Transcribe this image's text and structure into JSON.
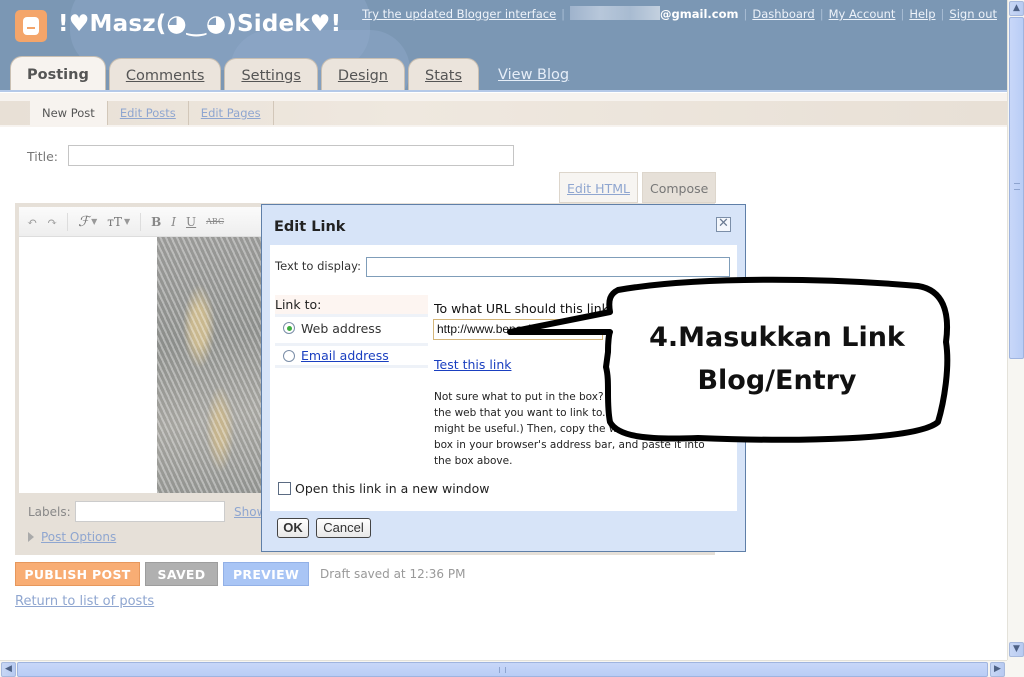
{
  "header": {
    "blog_title": "!♥Masz(◕‿◕)Sidek♥!",
    "logo_icon": "blogger-logo-icon",
    "top_links": {
      "try_updated": "Try the updated Blogger interface",
      "email_suffix": "@gmail.com",
      "dashboard": "Dashboard",
      "my_account": "My Account",
      "help": "Help",
      "sign_out": "Sign out"
    },
    "tabs": [
      {
        "label": "Posting",
        "active": true
      },
      {
        "label": "Comments",
        "active": false
      },
      {
        "label": "Settings",
        "active": false
      },
      {
        "label": "Design",
        "active": false
      },
      {
        "label": "Stats",
        "active": false
      }
    ],
    "view_blog": "View Blog"
  },
  "subnav": {
    "items": [
      {
        "label": "New Post",
        "active": true
      },
      {
        "label": "Edit Posts",
        "active": false
      },
      {
        "label": "Edit Pages",
        "active": false
      }
    ]
  },
  "post": {
    "title_label": "Title:",
    "title_value": "",
    "mode_tabs": [
      {
        "label": "Edit HTML",
        "active": false
      },
      {
        "label": "Compose",
        "active": true
      }
    ],
    "toolbar": {
      "undo_icon": "undo-icon",
      "redo_icon": "redo-icon",
      "font_glyph": "ℱ",
      "font_size_glyph": "тT",
      "bold": "B",
      "italic": "I",
      "underline": "U",
      "strike": "ABC"
    },
    "labels_label": "Labels:",
    "labels_value": "",
    "show_all": "Show",
    "post_options": "Post Options"
  },
  "actions": {
    "publish": "PUBLISH POST",
    "saved": "SAVED",
    "preview": "PREVIEW",
    "draft_status": "Draft saved at 12:36 PM",
    "return_link": "Return to list of posts"
  },
  "dialog": {
    "title": "Edit Link",
    "close_icon": "close-icon",
    "text_to_display_label": "Text to display:",
    "text_to_display_value": "",
    "link_to_label": "Link to:",
    "options": [
      {
        "label": "Web address",
        "checked": true
      },
      {
        "label": "Email address",
        "checked": false
      }
    ],
    "url_question": "To what URL should this link go?",
    "url_value": "http://www.benashaari.com/",
    "test_link": "Test this link",
    "help_text": "Not sure what to put in the box? First, find the page on the web that you want to link to. (A search engine might be useful.) Then, copy the web address from the box in your browser's address bar, and paste it into the box above.",
    "open_new_window": "Open this link in a new window",
    "open_new_window_checked": false,
    "ok": "OK",
    "cancel": "Cancel"
  },
  "annotation": {
    "line1": "4.Masukkan Link",
    "line2": "Blog/Entry"
  },
  "colors": {
    "header_bg": "#7b97b4",
    "publish": "#f8ad74",
    "saved": "#b0b0b0",
    "preview": "#a9c5f5",
    "link": "#8fa6d0",
    "dialog_bg": "#d7e4f8"
  }
}
